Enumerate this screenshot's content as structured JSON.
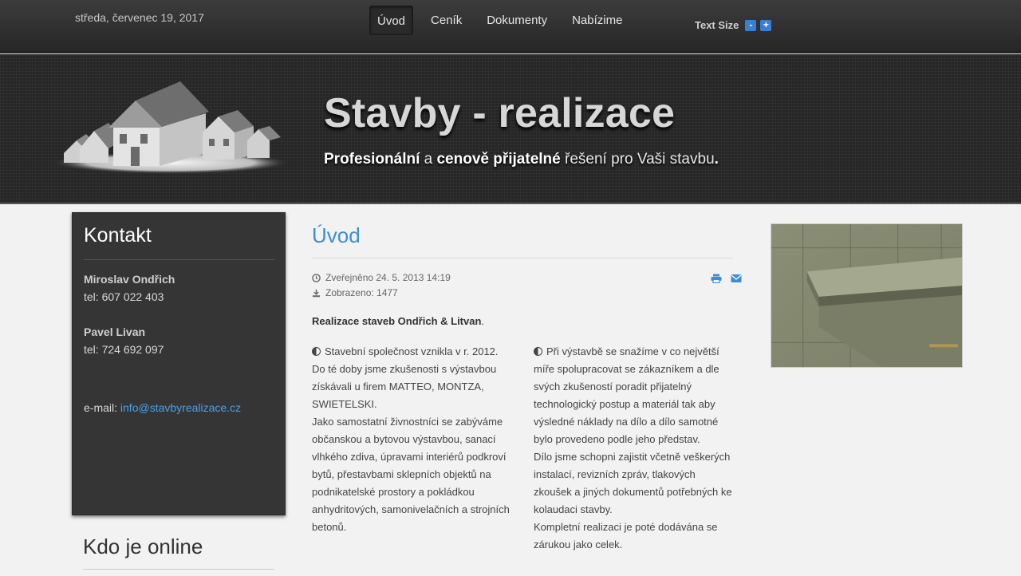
{
  "topbar": {
    "date": "středa, červenec 19, 2017",
    "nav": [
      {
        "label": "Úvod",
        "active": true
      },
      {
        "label": "Ceník",
        "active": false
      },
      {
        "label": "Dokumenty",
        "active": false
      },
      {
        "label": "Nabízime",
        "active": false
      }
    ],
    "text_size": {
      "label": "Text Size",
      "decrease": "-",
      "increase": "+"
    }
  },
  "banner": {
    "title": "Stavby - realizace",
    "slogan": {
      "part1": "Profesionální",
      "part2": " a ",
      "part3": "cenově přijatelné",
      "part4": " řešení pro Vaši stavbu",
      "part5": "."
    }
  },
  "sidebar": {
    "title": "Kontakt",
    "contacts": [
      {
        "name": "Miroslav Ondřich",
        "phone": "tel: 607 022 403"
      },
      {
        "name": "Pavel Livan",
        "phone": "tel: 724 692 097"
      }
    ],
    "email_label": "e-mail: ",
    "email": "info@stavbyrealizace.cz",
    "online_title": "Kdo je online"
  },
  "article": {
    "title": "Úvod",
    "published": "Zveřejněno 24. 5. 2013 14:19",
    "hits": "Zobrazeno: 1477",
    "lead_bold": "Realizace staveb Ondřich & Litvan",
    "lead_end": ".",
    "col_left": "Stavební společnost vznikla v r. 2012. Do té doby jsme zkušenosti s výstavbou získávali u firem MATTEO, MONTZA, SWIETELSKI.",
    "col_left_2": "Jako samostatní živnostníci se zabýváme občanskou a bytovou výstavbou, sanací vlhkého zdiva, úpravami interiérů podkroví bytů, přestavbami sklepních objektů na podnikatelské prostory a pokládkou anhydritových, samonivelačních a strojních betonů.",
    "col_right": "Při výstavbě se snažíme v co největší míře spolupracovat se zákazníkem a dle svých zkušeností poradit přijatelný technologický postup a materiál tak aby výsledné náklady na dílo a dílo samotné bylo provedeno podle jeho představ.",
    "col_right_2": "Dílo jsme schopni zajistit včetně veškerých instalací, revizních zpráv, tlakových zkoušek a jiných dokumentů potřebných ke kolaudaci stavby.",
    "col_right_3": "Kompletní realizaci je poté dodávána se zárukou jako celek."
  },
  "colors": {
    "accent": "#3a8ed6",
    "link": "#4aa0e6",
    "topbar": "#2f2f2f",
    "sidebar": "#353535",
    "ts_button": "#3a7fd2"
  },
  "icons": {
    "published": "clock-icon",
    "hits": "download-icon",
    "print": "print-icon",
    "email": "envelope-icon",
    "bullet": "half-circle-icon"
  }
}
